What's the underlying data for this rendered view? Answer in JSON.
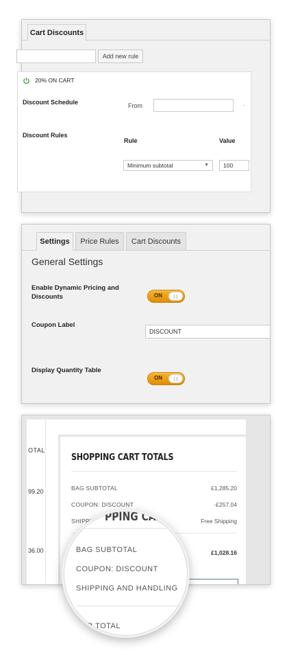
{
  "panel1": {
    "tab": "Cart Discounts",
    "add_rule_button": "Add new rule",
    "rule_name_value": "",
    "rule_title": "20% ON CART",
    "discount_schedule_label": "Discount Schedule",
    "from_label": "From",
    "from_value": "",
    "discount_rules_label": "Discount Rules",
    "rule_header": "Rule",
    "value_header": "Value",
    "rule_select": "Minimum subtotal",
    "value": "100"
  },
  "panel2": {
    "tabs": [
      "Settings",
      "Price Rules",
      "Cart Discounts"
    ],
    "heading": "General Settings",
    "enable_label": "Enable Dynamic Pricing and Discounts",
    "enable_toggle": "ON",
    "coupon_label": "Coupon Label",
    "coupon_value": "DISCOUNT",
    "qty_label": "Display Quantity Table",
    "qty_toggle": "ON"
  },
  "panel3": {
    "left_header": "OTAL",
    "left_value_1": "99.20",
    "left_value_2": "36.00",
    "title": "SHOPPING CART TOTALS",
    "rows": [
      {
        "label": "BAG SUBTOTAL",
        "value": "£1,285.20"
      },
      {
        "label": "COUPON: DISCOUNT",
        "value": "-£257.04"
      },
      {
        "label": "SHIPPING AND HANDLING",
        "value": "Free Shipping"
      }
    ],
    "total_value": "£1,028.16"
  },
  "magnifier": {
    "title": "PPING CAR",
    "rows": [
      "BAG SUBTOTAL",
      "COUPON: DISCOUNT",
      "SHIPPING AND HANDLING"
    ],
    "order_total": "DER TOTAL"
  }
}
